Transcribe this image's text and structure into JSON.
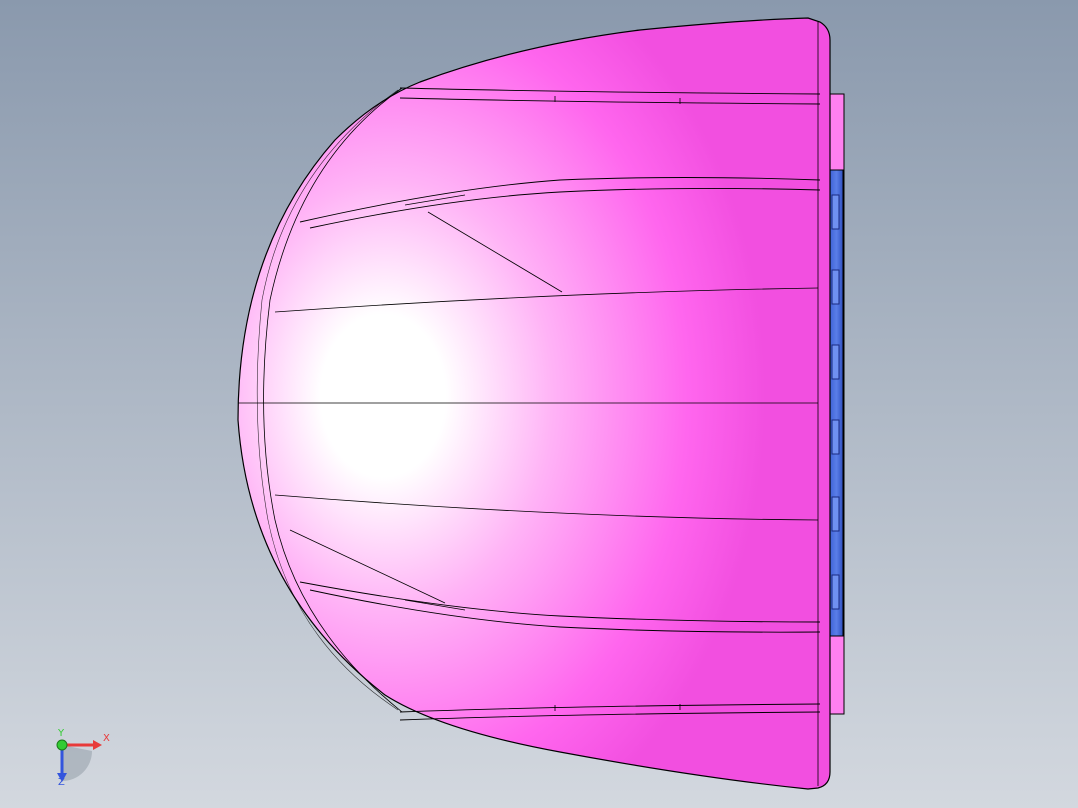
{
  "viewport": {
    "background_top": "#8a99ad",
    "background_bottom": "#d3d8df"
  },
  "model": {
    "face_color": "#ff66ee",
    "highlight_color": "#ffffff",
    "edge_color": "#000000",
    "hinge_color": "#5a7ee8"
  },
  "triad": {
    "x_label": "X",
    "y_label": "Y",
    "z_label": "Z",
    "x_color": "#e83a3a",
    "y_color": "#33cc33",
    "z_color": "#3355dd"
  }
}
